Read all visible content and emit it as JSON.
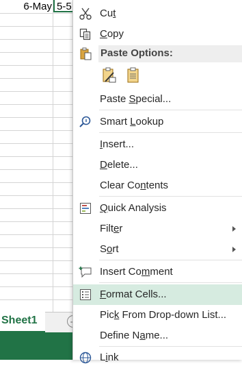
{
  "sheet": {
    "cell_date": "6-May",
    "cell_active": "5-5",
    "tab_name": "Sheet1",
    "add_sheet_symbol": "+"
  },
  "menu": {
    "cut": {
      "pre": "Cu",
      "acc": "t",
      "post": "",
      "icon": "scissors-icon"
    },
    "copy": {
      "pre": "",
      "acc": "C",
      "post": "opy",
      "icon": "copy-icon"
    },
    "paste_options": {
      "label": "Paste Options:",
      "icon": "clipboard-icon"
    },
    "paste_buttons": [
      "paste-formatting-icon",
      "paste-icon"
    ],
    "paste_special": {
      "pre": "Paste ",
      "acc": "S",
      "post": "pecial..."
    },
    "smart_lookup": {
      "pre": "Smart ",
      "acc": "L",
      "post": "ookup",
      "icon": "search-icon"
    },
    "insert": {
      "pre": "",
      "acc": "I",
      "post": "nsert..."
    },
    "delete": {
      "pre": "",
      "acc": "D",
      "post": "elete..."
    },
    "clear_contents": {
      "pre": "Clear Co",
      "acc": "n",
      "post": "tents"
    },
    "quick_analysis": {
      "pre": "",
      "acc": "Q",
      "post": "uick Analysis",
      "icon": "quick-analysis-icon"
    },
    "filter": {
      "pre": "Filt",
      "acc": "e",
      "post": "r"
    },
    "sort": {
      "pre": "S",
      "acc": "o",
      "post": "rt"
    },
    "insert_comment": {
      "pre": "Insert Co",
      "acc": "m",
      "post": "ment",
      "icon": "comment-icon"
    },
    "format_cells": {
      "pre": "",
      "acc": "F",
      "post": "ormat Cells...",
      "icon": "format-cells-icon"
    },
    "pick_list": {
      "pre": "Pic",
      "acc": "k",
      "post": " From Drop-down List..."
    },
    "define_name": {
      "pre": "Define N",
      "acc": "a",
      "post": "me..."
    },
    "link": {
      "pre": "L",
      "acc": "i",
      "post": "nk",
      "icon": "link-icon"
    }
  },
  "colors": {
    "excel_green": "#217346",
    "highlight": "#d6ebe0",
    "menu_text": "#262626"
  }
}
